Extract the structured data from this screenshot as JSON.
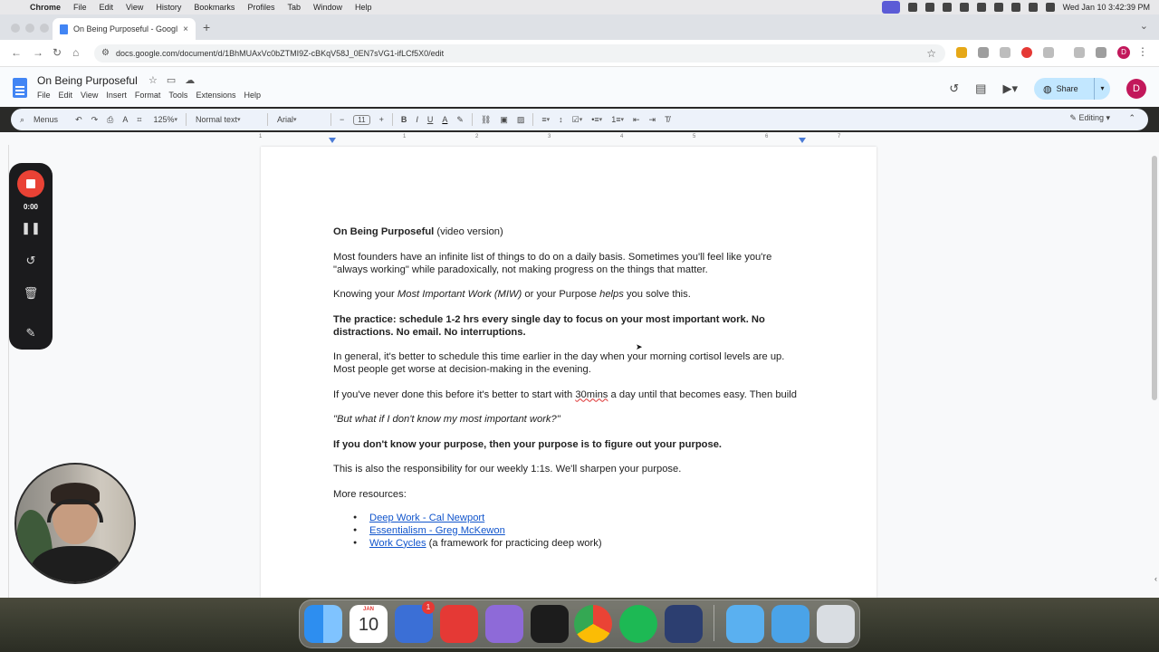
{
  "menubar": {
    "app": "Chrome",
    "items": [
      "File",
      "Edit",
      "View",
      "History",
      "Bookmarks",
      "Profiles",
      "Tab",
      "Window",
      "Help"
    ],
    "clock": "Wed Jan 10  3:42:39 PM"
  },
  "browser": {
    "tab_title": "On Being Purposeful - Googl",
    "url": "docs.google.com/document/d/1BhMUAxVc0bZTMI9Z-cBKqV58J_0EN7sVG1-ifLCf5X0/edit",
    "profile_initial": "D"
  },
  "docs": {
    "title": "On Being Purposeful",
    "menu": [
      "File",
      "Edit",
      "View",
      "Insert",
      "Format",
      "Tools",
      "Extensions",
      "Help"
    ],
    "share_label": "Share",
    "avatar_initial": "D"
  },
  "toolbar": {
    "search_label": "Menus",
    "zoom": "125%",
    "style": "Normal text",
    "font": "Arial",
    "font_size": "11",
    "mode": "Editing"
  },
  "ruler": [
    "1",
    "1",
    "2",
    "3",
    "4",
    "5",
    "6",
    "7"
  ],
  "document": {
    "heading_bold": "On Being Purposeful",
    "heading_rest": " (video version)",
    "p1": "Most founders have an infinite list of things to do on a daily basis. Sometimes you'll feel like you're \"always working\" while paradoxically, not making progress on the things that matter.",
    "p2_a": "Knowing your ",
    "p2_b": "Most Important Work (MIW)",
    "p2_c": " or your Purpose ",
    "p2_d": "helps",
    "p2_e": " you solve this.",
    "p3": "The practice: schedule 1-2 hrs every single day to focus on your most important work. No distractions. No email. No interruptions.",
    "p4": "In general, it's better to schedule this time earlier in the day when your morning cortisol levels are up. Most people get worse at decision-making in the evening.",
    "p5_a": "If you've never done this before it's better to start with ",
    "p5_b": "30mins",
    "p5_c": " a day until that becomes easy. Then build",
    "p6": "\"But what if I don't know my most important work?\"",
    "p7": "If you don't know your purpose, then your purpose is to figure out your purpose.",
    "p8": "This is also the responsibility for our weekly 1:1s. We'll sharpen your purpose.",
    "p9": "More resources:",
    "resources": [
      {
        "link": "Deep Work - Cal Newport",
        "rest": ""
      },
      {
        "link": "Essentialism - Greg McKewon",
        "rest": ""
      },
      {
        "link": "Work Cycles",
        "rest": " (a framework for practicing deep work)"
      }
    ]
  },
  "recorder": {
    "time": "0:00"
  },
  "dock": {
    "calendar_month": "JAN",
    "calendar_day": "10",
    "badge": "1"
  },
  "colors": {
    "share_bg": "#c2e7ff",
    "link": "#1155cc",
    "record_red": "#e94235"
  }
}
